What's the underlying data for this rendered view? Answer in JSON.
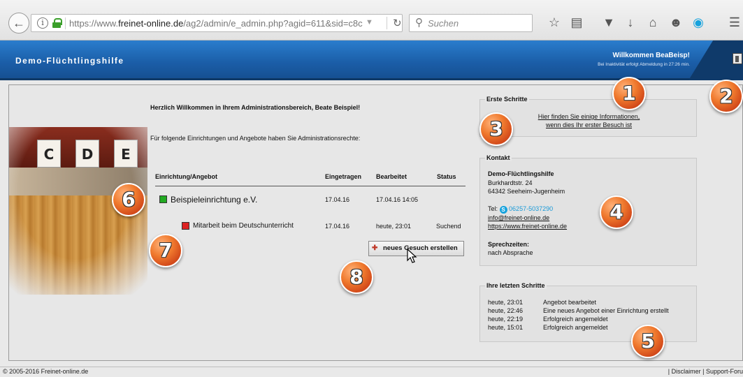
{
  "browser": {
    "url_prefix": "https://www.",
    "url_domain": "freinet-online.de",
    "url_path": "/ag2/admin/e_admin.php?agid=611&sid=c8c",
    "search_placeholder": "Suchen"
  },
  "header": {
    "title": "Demo-Flüchtlingshilfe",
    "welcome": "Willkommen  BeaBeisp!",
    "logout_note": "Bei Inaktivität erfolgt Abmeldung in 27:26 min."
  },
  "main": {
    "welcome": "Herzlich Willkommen in Ihrem Administrationsbereich, Beate Beispiel!",
    "rights": "Für folgende Einrichtungen und Angebote haben Sie Administrationsrechte:",
    "photo_letters": [
      "C",
      "D",
      "E"
    ],
    "table": {
      "headers": [
        "Einrichtung/Angebot",
        "Eingetragen",
        "Bearbeitet",
        "Status"
      ],
      "rows": [
        {
          "name": "Beispieleinrichtung e.V.",
          "eingetragen": "17.04.16",
          "bearbeitet": "17.04.16 14:05",
          "status": "",
          "color": "#22aa22"
        },
        {
          "name": "Mitarbeit beim Deutschunterricht",
          "eingetragen": "17.04.16",
          "bearbeitet": "heute, 23:01",
          "status": "Suchend",
          "color": "#dd2222"
        }
      ]
    },
    "new_request_button": "neues Gesuch erstellen"
  },
  "erste_schritte": {
    "title": "Erste Schritte",
    "link_line1": "Hier finden Sie einige Informationen,",
    "link_line2": "wenn dies Ihr erster Besuch ist"
  },
  "kontakt": {
    "title": "Kontakt",
    "name": "Demo-Flüchtlingshilfe",
    "street": "Burkhardtstr. 24",
    "city": "64342 Seeheim-Jugenheim",
    "tel_label": "Tel:",
    "tel": "06257-5037290",
    "email": "info@freinet-online.de",
    "website": "https://www.freinet-online.de",
    "hours_title": "Sprechzeiten:",
    "hours": "nach Absprache"
  },
  "steps": {
    "title": "Ihre letzten Schritte",
    "items": [
      {
        "time": "heute, 23:01",
        "text": "Angebot bearbeitet"
      },
      {
        "time": "heute, 22:46",
        "text": "Eine neues Angebot einer Einrichtung erstellt"
      },
      {
        "time": "heute, 22:19",
        "text": "Erfolgreich angemeldet"
      },
      {
        "time": "heute, 15:01",
        "text": "Erfolgreich angemeldet"
      }
    ]
  },
  "badges": [
    "1",
    "2",
    "3",
    "4",
    "5",
    "6",
    "7",
    "8"
  ],
  "footer": {
    "copyright": "© 2005-2016 Freinet-online.de",
    "links": "| Disclaimer | Support-Foru"
  }
}
